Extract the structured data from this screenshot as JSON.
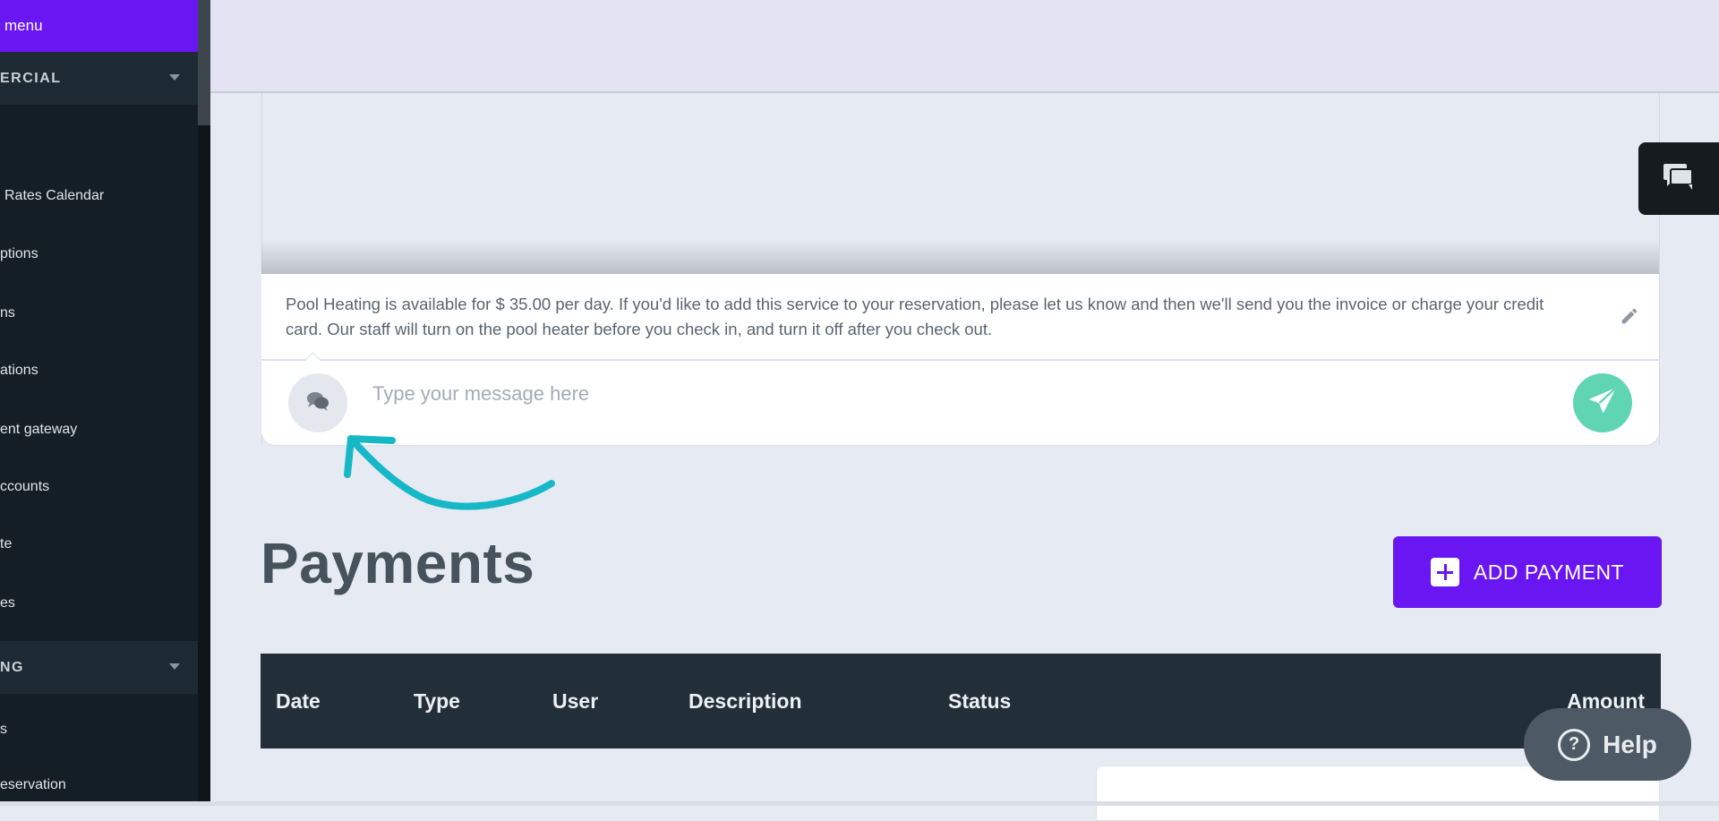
{
  "sidebar": {
    "menu_label": "menu",
    "section_commercial": "ERCIAL",
    "items_commercial": [
      "Rates Calendar",
      "ptions",
      "ns",
      "ations",
      "ent gateway",
      "ccounts",
      "te",
      "es"
    ],
    "section_booking": "NG",
    "items_booking": [
      "s",
      "eservation"
    ]
  },
  "chat": {
    "template_text": "Pool Heating is available for $ 35.00 per day. If you'd like to add this service to your reservation, please let us know and then we'll send you the invoice or charge your credit card. Our staff will turn on the pool heater before you check in, and turn it off after you check out.",
    "input_placeholder": "Type your message here"
  },
  "payments": {
    "title": "Payments",
    "add_button_label": "ADD PAYMENT",
    "columns": [
      "Date",
      "Type",
      "User",
      "Description",
      "Status",
      "Amount"
    ]
  },
  "help": {
    "label": "Help",
    "icon": "?"
  },
  "colors": {
    "accent": "#6a16f3",
    "send": "#5fd5b4",
    "annotation": "#16b8c8",
    "sidebar_bg": "#141e26",
    "table_head": "#222e38"
  },
  "icons": {
    "section_caret": "caret-down-icon",
    "pencil": "pencil-icon",
    "template_bubbles": "chat-bubbles-icon",
    "send": "send-icon",
    "chat_tab": "chat-icon",
    "plus": "plus-icon",
    "help": "question-circle-icon"
  }
}
